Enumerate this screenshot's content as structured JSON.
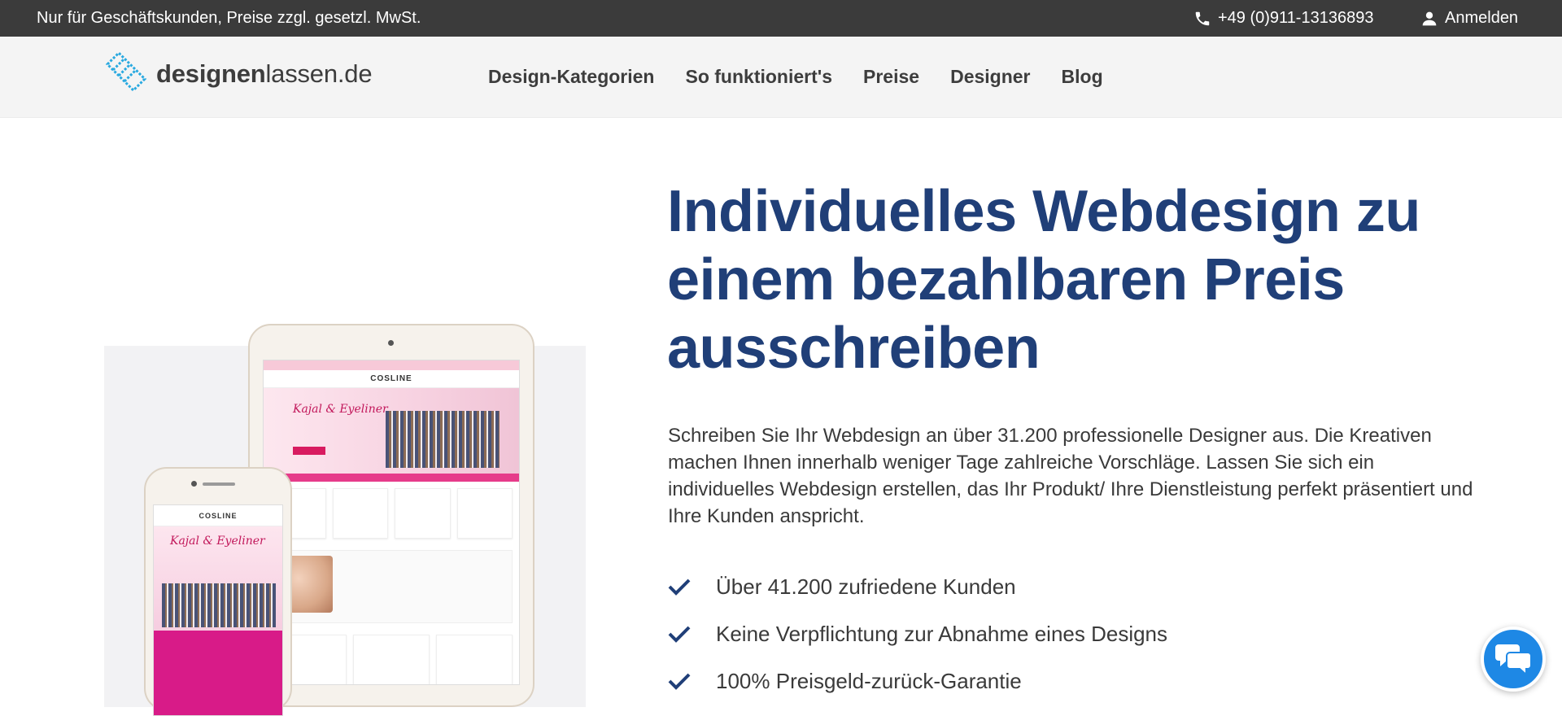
{
  "topbar": {
    "notice": "Nur für Geschäftskunden, Preise zzgl. gesetzl. MwSt.",
    "phone": "+49 (0)911-13136893",
    "login": "Anmelden"
  },
  "logo": {
    "bold": "designen",
    "regular": "lassen.de",
    "color": "#29a9e0"
  },
  "nav": {
    "items": [
      "Design-Kategorien",
      "So funktioniert's",
      "Preise",
      "Designer",
      "Blog"
    ]
  },
  "hero": {
    "headline": "Individuelles Webdesign zu einem bezahlbaren Preis ausschreiben",
    "description": "Schreiben Sie Ihr Webdesign an über 31.200 professionelle Designer aus. Die Kreativen machen Ihnen innerhalb weniger Tage zahlreiche Vorschläge. Lassen Sie sich ein individuelles Webdesign erstellen, das Ihr Produkt/ Ihre Dienstleistung perfekt präsentiert und Ihre Kunden anspricht.",
    "benefits": [
      "Über 41.200 zufriedene Kunden",
      "Keine Verpflichtung zur Abnahme eines Designs",
      "100% Preisgeld-zurück-Garantie"
    ],
    "mockup": {
      "brand": "COSLINE",
      "title": "Kajal & Eyeliner"
    }
  },
  "colors": {
    "topbar": "#3b3b3b",
    "headline": "#203f78",
    "check": "#203f78",
    "chat": "#1e88e5"
  },
  "icons": {
    "phone": "phone-icon",
    "login": "user-icon",
    "check": "check-icon",
    "chat": "chat-bubbles-icon"
  }
}
